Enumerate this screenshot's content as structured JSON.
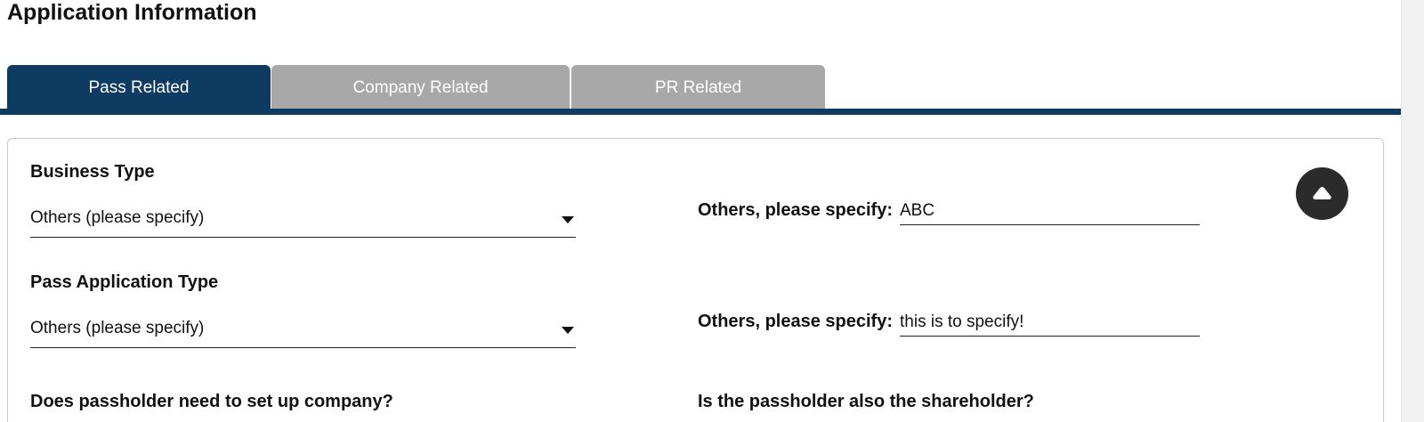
{
  "page": {
    "title": "Application Information"
  },
  "tabs": [
    {
      "label": "Pass Related",
      "active": true
    },
    {
      "label": "Company Related",
      "active": false
    },
    {
      "label": "PR Related",
      "active": false
    }
  ],
  "colors": {
    "active_tab": "#0d3b61",
    "inactive_tab": "#a8a8a8",
    "collapse_button": "#2b2b2b"
  },
  "form": {
    "business_type": {
      "label": "Business Type",
      "selected": "Others (please specify)",
      "specify_label": "Others, please specify:",
      "specify_value": "ABC"
    },
    "pass_application_type": {
      "label": "Pass Application Type",
      "selected": "Others (please specify)",
      "specify_label": "Others, please specify:",
      "specify_value": "this is to specify!"
    },
    "setup_company": {
      "label": "Does passholder need to set up company?"
    },
    "shareholder": {
      "label": "Is the passholder also the shareholder?"
    }
  },
  "icons": {
    "collapse": "chevron-up-icon",
    "dropdown": "caret-down-icon"
  }
}
